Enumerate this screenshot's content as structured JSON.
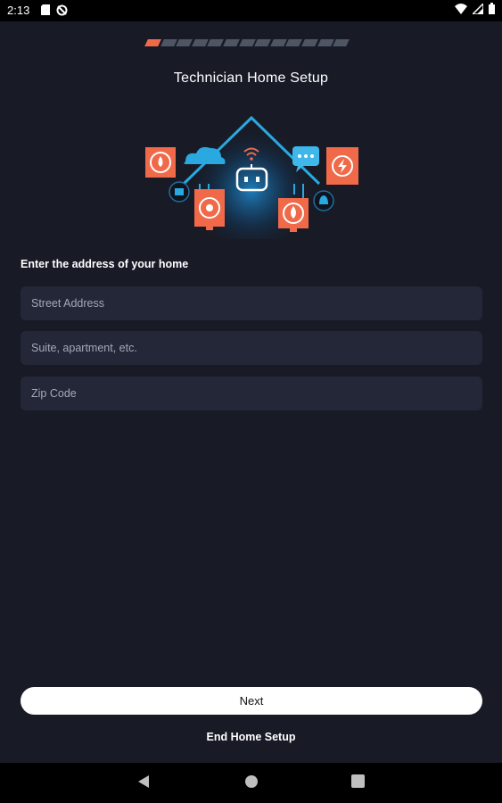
{
  "status_bar": {
    "time": "2:13",
    "icons_left": [
      "sd-card-icon",
      "sync-off-icon"
    ],
    "icons_right": [
      "wifi-icon",
      "signal-icon",
      "battery-icon"
    ]
  },
  "progress": {
    "total_steps": 13,
    "current_step": 1,
    "active_color": "#f06a4a",
    "inactive_color": "#4e5565"
  },
  "header": {
    "title": "Technician Home Setup"
  },
  "hero": {
    "icons": [
      "house-icon",
      "robot-icon",
      "wifi-icon",
      "cloud-icon",
      "chat-icon",
      "water-drop-icon",
      "lightning-icon",
      "sun-icon",
      "flame-icon",
      "calendar-icon",
      "bell-icon"
    ],
    "accent_color": "#2aa8e0",
    "card_color": "#f06a4a"
  },
  "form": {
    "prompt": "Enter the address of your home",
    "street": {
      "placeholder": "Street Address",
      "value": ""
    },
    "suite": {
      "placeholder": "Suite, apartment, etc.",
      "value": ""
    },
    "zip": {
      "placeholder": "Zip Code",
      "value": ""
    }
  },
  "actions": {
    "next_label": "Next",
    "end_label": "End Home Setup"
  },
  "nav_bar": {
    "icons": [
      "back-icon",
      "home-icon",
      "recents-icon"
    ]
  }
}
